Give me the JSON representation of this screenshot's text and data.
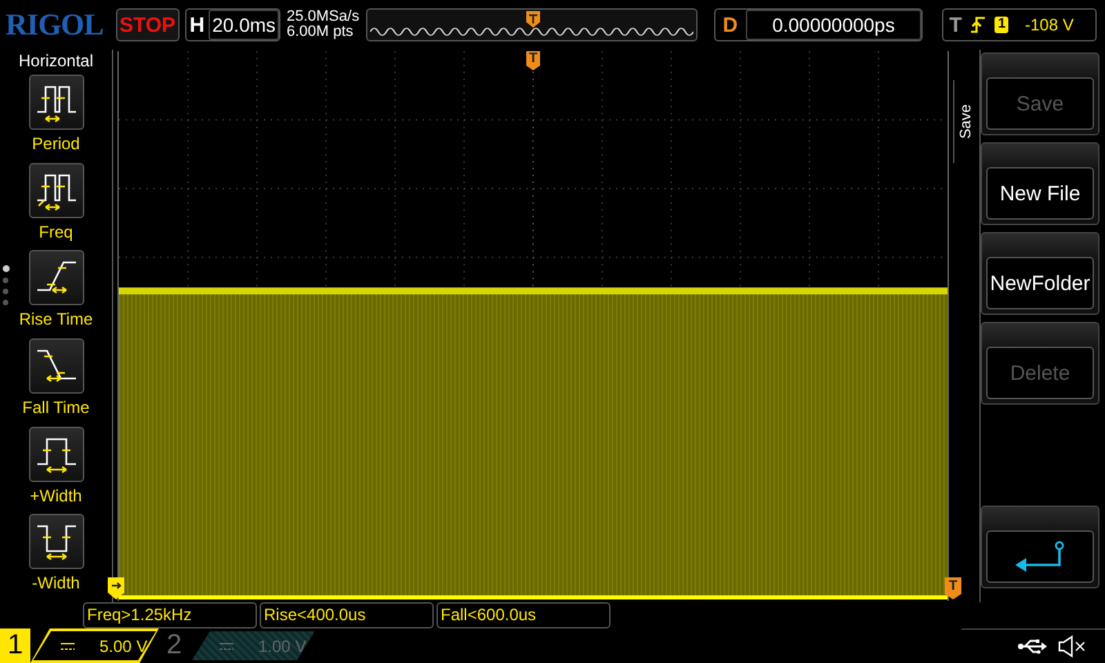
{
  "header": {
    "logo": "RIGOL",
    "run_state": "STOP",
    "timebase_label": "H",
    "timebase": "20.0ms",
    "sample_rate": "25.0MSa/s",
    "memory_depth": "6.00M pts",
    "delay_label": "D",
    "delay": "0.00000000ps",
    "trigger_label": "T",
    "trigger_source": "1",
    "trigger_level": "-108 V"
  },
  "left_menu": {
    "title": "Horizontal",
    "page_dots": [
      {
        "selected": true
      },
      {
        "selected": false
      },
      {
        "selected": false
      },
      {
        "selected": false
      }
    ],
    "items": [
      {
        "kind": "period",
        "label": "Period"
      },
      {
        "kind": "freq",
        "label": "Freq"
      },
      {
        "kind": "rise",
        "label": "Rise Time"
      },
      {
        "kind": "fall",
        "label": "Fall Time"
      },
      {
        "kind": "pwidth",
        "label": "+Width"
      },
      {
        "kind": "nwidth",
        "label": "-Width"
      }
    ]
  },
  "screen": {
    "trigger_marker": "T",
    "level_marker": "T"
  },
  "right_menu": {
    "title": "Save",
    "buttons": [
      {
        "kind": "text",
        "label": "Save",
        "disabled": true
      },
      {
        "kind": "text",
        "label": "New File",
        "disabled": false
      },
      {
        "kind": "text",
        "label": "NewFolder",
        "disabled": false
      },
      {
        "kind": "text",
        "label": "Delete",
        "disabled": true
      },
      {
        "kind": "spacer"
      },
      {
        "kind": "back"
      }
    ]
  },
  "measurements": [
    "Freq>1.25kHz",
    "Rise<400.0us",
    "Fall<600.0us"
  ],
  "channels": [
    {
      "number": "1",
      "scale": "5.00 V",
      "on": true
    },
    {
      "number": "2",
      "scale": "1.00 V",
      "on": false
    }
  ]
}
